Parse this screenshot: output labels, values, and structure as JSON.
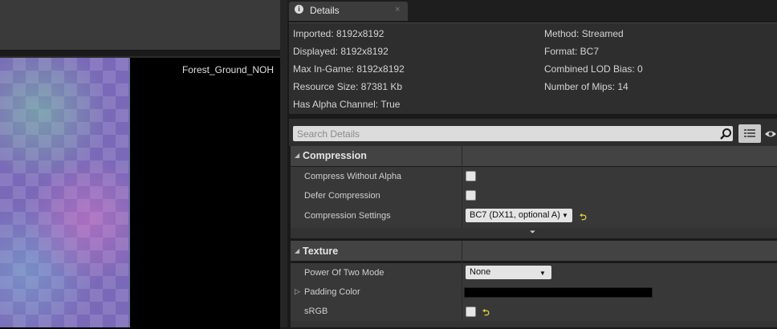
{
  "viewport": {
    "texture_name": "Forest_Ground_NOH"
  },
  "tab": {
    "label": "Details",
    "close": "×",
    "info_icon": "info-icon"
  },
  "info": {
    "imported": "Imported: 8192x8192",
    "displayed": "Displayed: 8192x8192",
    "max_in_game": "Max In-Game: 8192x8192",
    "resource_size": "Resource Size: 87381 Kb",
    "has_alpha": "Has Alpha Channel: True",
    "method": "Method: Streamed",
    "format": "Format: BC7",
    "lod_bias": "Combined LOD Bias: 0",
    "num_mips": "Number of Mips: 14"
  },
  "search": {
    "placeholder": "Search Details"
  },
  "categories": {
    "compression": {
      "label": "Compression",
      "rows": {
        "compress_without_alpha": {
          "label": "Compress Without Alpha",
          "checked": false
        },
        "defer_compression": {
          "label": "Defer Compression",
          "checked": false
        },
        "compression_settings": {
          "label": "Compression Settings",
          "value": "BC7 (DX11, optional A)"
        }
      }
    },
    "texture": {
      "label": "Texture",
      "rows": {
        "power_of_two": {
          "label": "Power Of Two Mode",
          "value": "None"
        },
        "padding_color": {
          "label": "Padding Color",
          "color": "#000000"
        },
        "srgb": {
          "label": "sRGB",
          "checked": false
        }
      }
    }
  },
  "colors": {
    "panel": "#2e2e2e",
    "category": "#434343",
    "row": "#383838",
    "reset_arrow": "#e8d23a"
  }
}
